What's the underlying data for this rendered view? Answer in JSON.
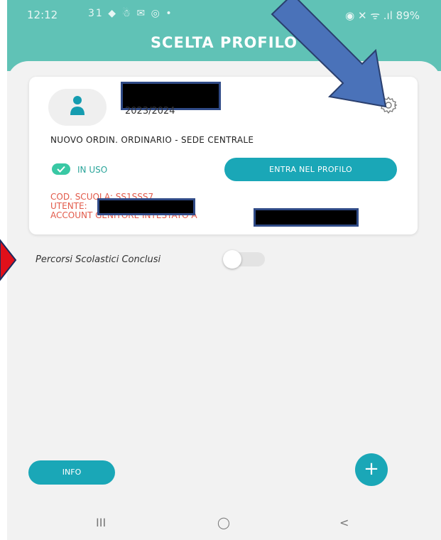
{
  "status_bar": {
    "time": "12:12",
    "icons": "31 ◆ ☃ ✉ ◎ •",
    "right": "◉ ✕ ᯤ .ıl 89%"
  },
  "header": {
    "title": "SCELTA PROFILO"
  },
  "profile_card": {
    "year": "2023/2024",
    "course": "NUOVO ORDIN. ORDINARIO - SEDE CENTRALE",
    "status_label": "IN USO",
    "enter_button": "ENTRA NEL PROFILO",
    "school_code_label": "COD. SCUOLA: SS1SSS7",
    "user_label": "UTENTE:",
    "account_label": "ACCOUNT GENITORE INTESTATO A"
  },
  "toggle": {
    "label": "Percorsi Scolastici Conclusi",
    "enabled": false
  },
  "info_button": "INFO",
  "fab_label": "+",
  "navbar": {
    "recent": "III",
    "home": "◯",
    "back": "<"
  },
  "colors": {
    "header": "#60c2b6",
    "accent": "#1aa7b7",
    "error_text": "#e25a4a",
    "arrow_blue": "#4a72b9",
    "arrow_red": "#e0101a"
  }
}
